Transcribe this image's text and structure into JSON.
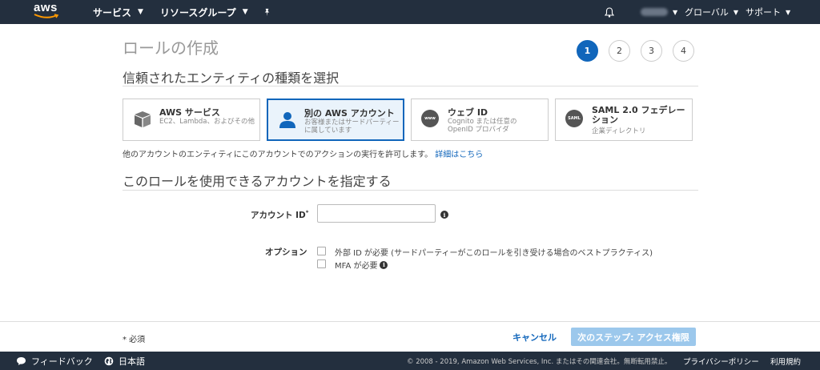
{
  "nav": {
    "logo": "aws",
    "services": "サービス",
    "resource_groups": "リソースグループ",
    "region": "グローバル",
    "support": "サポート",
    "icons": [
      "bell-icon",
      "pin-icon",
      "caret-down-icon"
    ]
  },
  "page": {
    "title": "ロールの作成",
    "steps": [
      "1",
      "2",
      "3",
      "4"
    ],
    "active_step": "1",
    "section1_title": "信頼されたエンティティの種類を選択",
    "section2_title": "このロールを使用できるアカウントを指定する"
  },
  "cards": [
    {
      "title": "AWS サービス",
      "desc": "EC2、Lambda、およびその他",
      "icon": "box-icon"
    },
    {
      "title": "別の AWS アカウント",
      "desc": "お客様またはサードパーティーに属しています",
      "icon": "user-icon"
    },
    {
      "title": "ウェブ ID",
      "desc": "Cognito または任意の OpenID プロバイダ",
      "icon": "web-id-icon",
      "icon_text": "www"
    },
    {
      "title": "SAML 2.0 フェデレーション",
      "desc": "企業ディレクトリ",
      "icon": "saml-icon",
      "icon_text": "SAML"
    }
  ],
  "helper": {
    "text": "他のアカウントのエンティティにこのアカウントでのアクションの実行を許可します。",
    "link": "詳細はこちら"
  },
  "form": {
    "account_id_label": "アカウント ID",
    "required_mark": "*",
    "account_id_value": "",
    "options_label": "オプション",
    "option_external_id": "外部 ID が必要 (サードパーティーがこのロールを引き受ける場合のベストプラクティス)",
    "option_mfa": "MFA が必要"
  },
  "actions": {
    "required_note": "* 必須",
    "cancel": "キャンセル",
    "next": "次のステップ: アクセス権限"
  },
  "footer": {
    "feedback": "フィードバック",
    "language": "日本語",
    "copyright": "© 2008 - 2019, Amazon Web Services, Inc. またはその関連会社。無断転用禁止。",
    "privacy": "プライバシーポリシー",
    "terms": "利用規約"
  },
  "colors": {
    "nav_bg": "#232f3e",
    "accent": "#1166bb",
    "selected_card_bg": "#eaf3fb",
    "disabled_button": "#9cc8ec",
    "aws_orange": "#ff9900"
  }
}
